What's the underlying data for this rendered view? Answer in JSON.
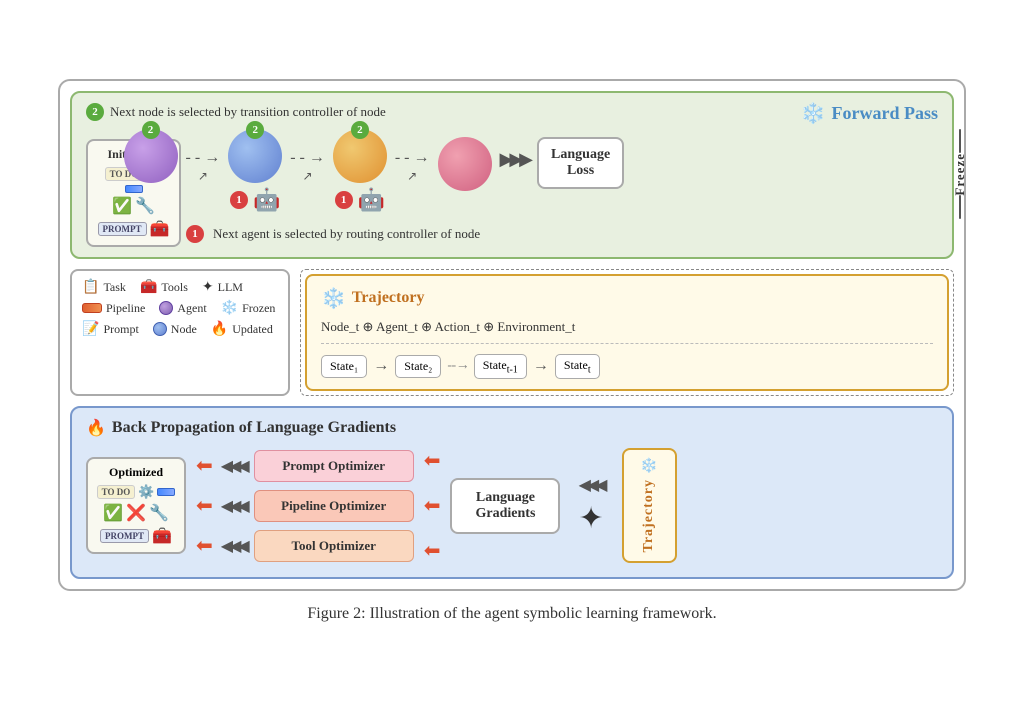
{
  "figure": {
    "caption": "Figure 2: Illustration of the agent symbolic learning framework."
  },
  "forward_pass": {
    "label": "Forward Pass",
    "top_note": "Next node is selected by transition controller of node",
    "top_note_num": "2",
    "bottom_note": "Next agent is selected by routing controller of node",
    "bottom_note_num": "1",
    "initialized_title": "Initialized",
    "optimized_title": "Optimized",
    "todo_label": "TO DO",
    "prompt_label": "PROMPT",
    "language_loss_label": "Language\nLoss",
    "freeze_label": "Freeze"
  },
  "trajectory": {
    "title": "Trajectory",
    "formula": "Node_t ⊕ Agent_t ⊕ Action_t ⊕ Environment_t",
    "states": [
      "State₁",
      "State₂",
      "State_{t-1}",
      "State_t"
    ]
  },
  "legend": {
    "items": [
      {
        "icon": "📋",
        "label": "Task"
      },
      {
        "icon": "🧰",
        "label": "Tools"
      },
      {
        "icon": "🤖",
        "label": "LLM"
      },
      {
        "icon": "⛓",
        "label": "Pipeline"
      },
      {
        "icon": "🤖",
        "label": "Agent"
      },
      {
        "icon": "❄",
        "label": "Frozen"
      },
      {
        "icon": "📝",
        "label": "Prompt"
      },
      {
        "icon": "🟣",
        "label": "Node"
      },
      {
        "icon": "🔥",
        "label": "Updated"
      }
    ]
  },
  "backprop": {
    "title": "Back Propagation of Language Gradients",
    "fire_icon": "🔥",
    "optimizers": [
      "Prompt Optimizer",
      "Pipeline Optimizer",
      "Tool Optimizer"
    ],
    "language_gradients_label": "Language\nGradients",
    "trajectory_side_label": "Trajectory"
  }
}
